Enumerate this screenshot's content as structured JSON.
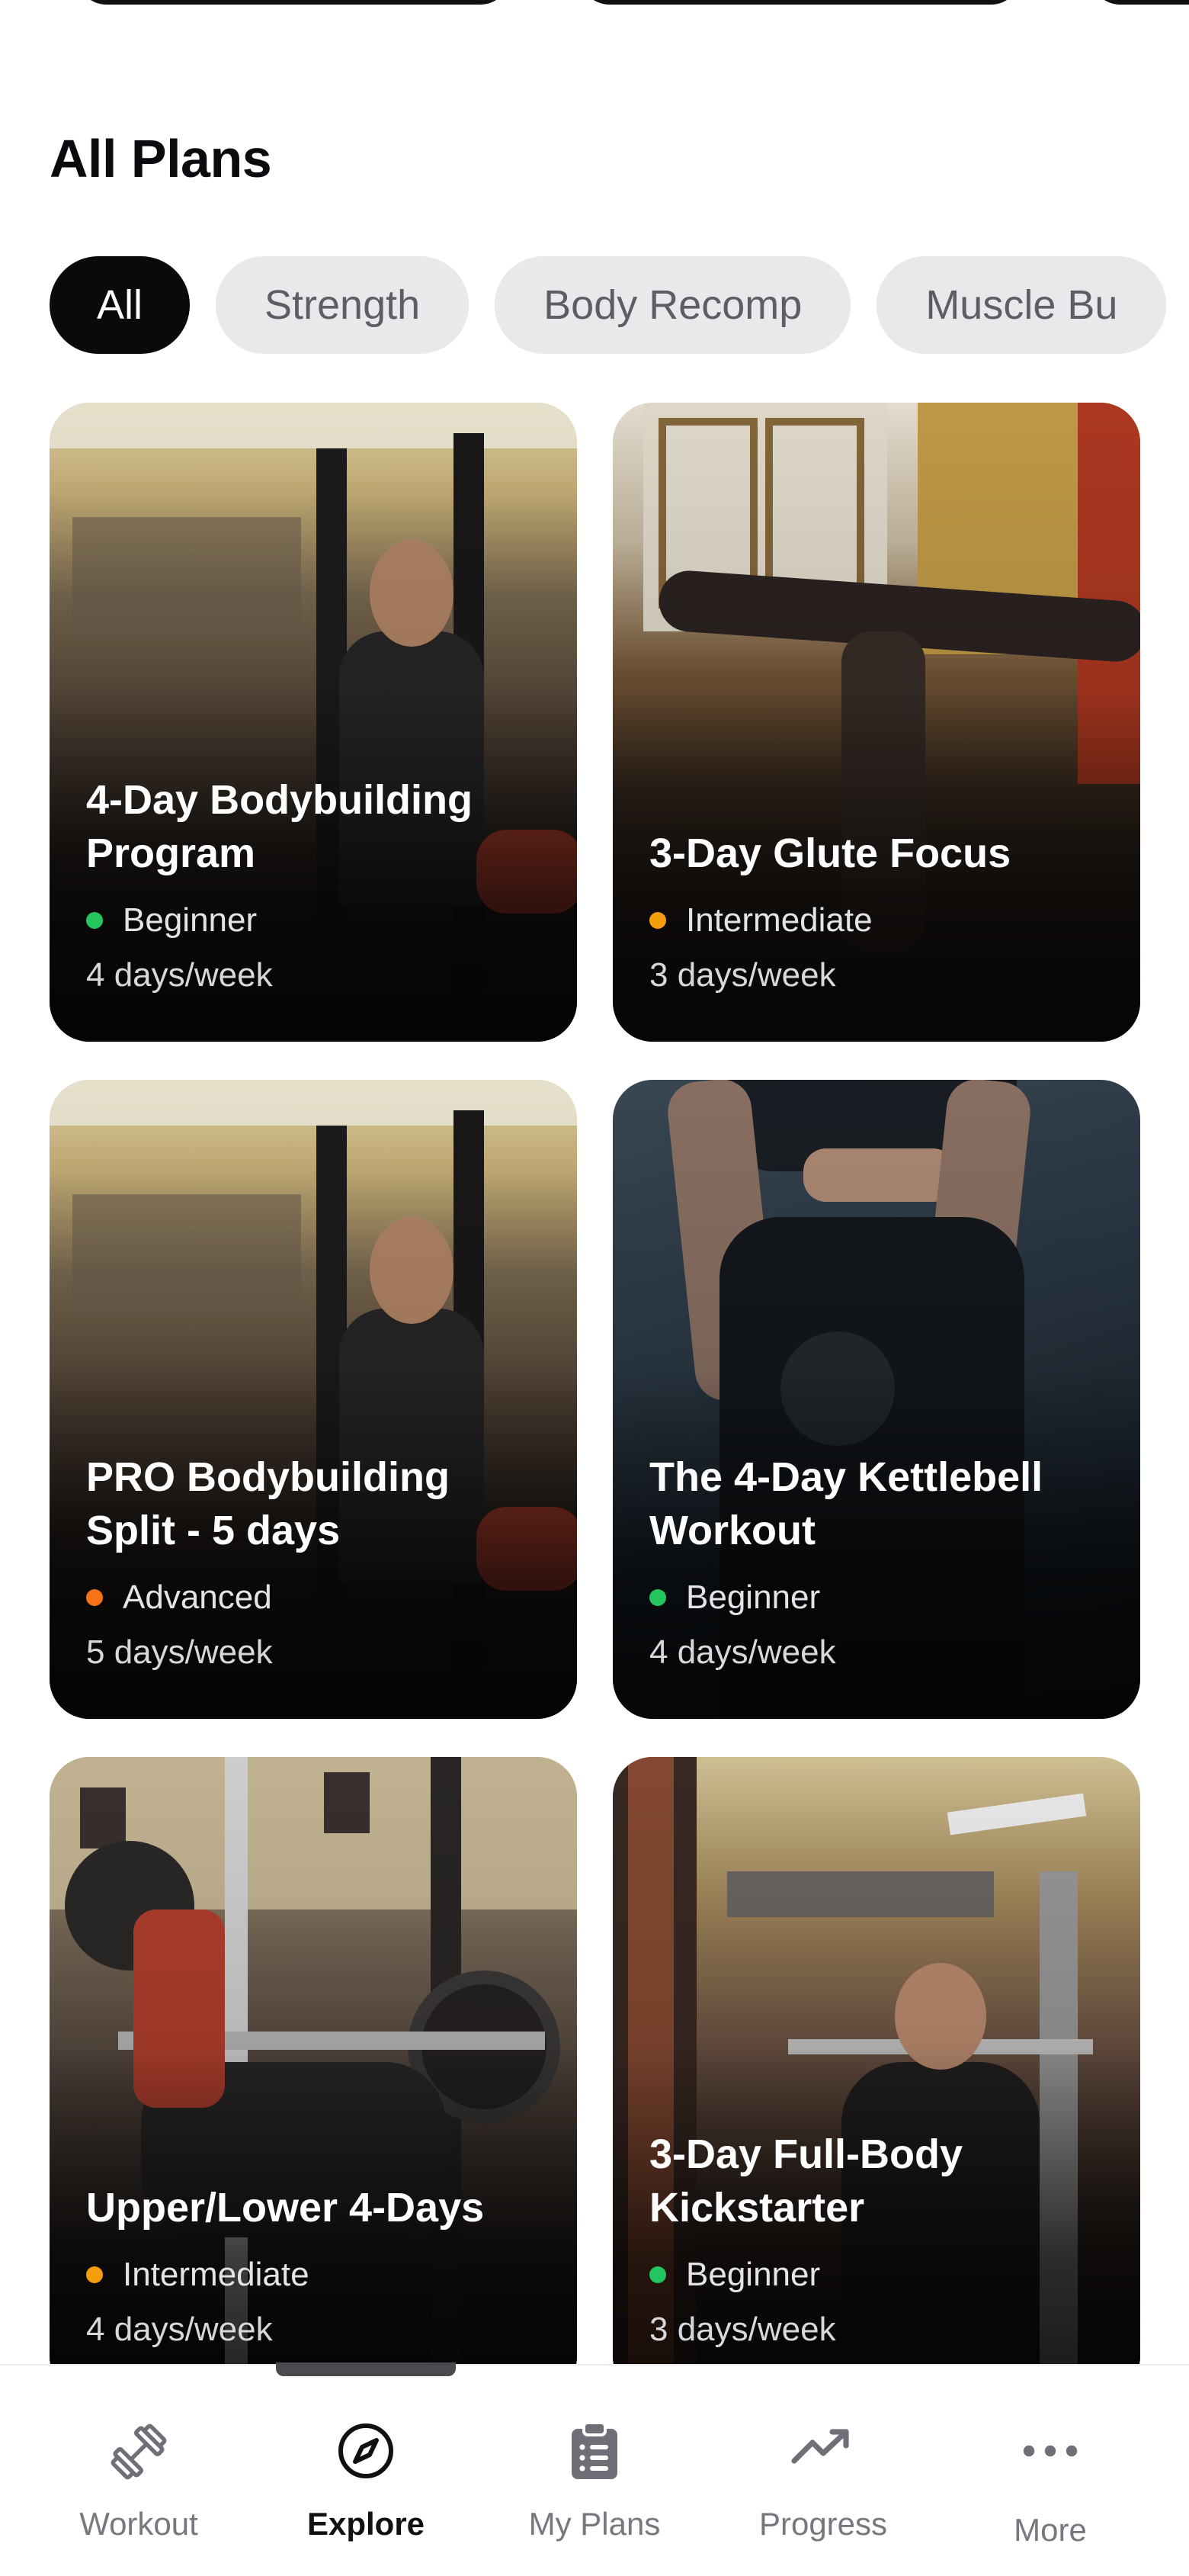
{
  "section": {
    "title": "All Plans"
  },
  "filters": [
    {
      "label": "All",
      "active": true
    },
    {
      "label": "Strength",
      "active": false
    },
    {
      "label": "Body Recomp",
      "active": false
    },
    {
      "label": "Muscle Bu",
      "active": false
    }
  ],
  "plans": [
    {
      "name": "4-Day Bodybuilding Program",
      "level": "Beginner",
      "level_color": "#22c55e",
      "frequency": "4 days/week"
    },
    {
      "name": "3-Day Glute Focus",
      "level": "Intermediate",
      "level_color": "#f59e0b",
      "frequency": "3 days/week"
    },
    {
      "name": "PRO Bodybuilding Split - 5 days",
      "level": "Advanced",
      "level_color": "#f97316",
      "frequency": "5 days/week"
    },
    {
      "name": "The 4-Day Kettlebell Workout",
      "level": "Beginner",
      "level_color": "#22c55e",
      "frequency": "4 days/week"
    },
    {
      "name": "Upper/Lower 4-Days",
      "level": "Intermediate",
      "level_color": "#f59e0b",
      "frequency": "4 days/week"
    },
    {
      "name": "3-Day Full-Body Kickstarter",
      "level": "Beginner",
      "level_color": "#22c55e",
      "frequency": "3 days/week"
    }
  ],
  "tabbar": {
    "workout": "Workout",
    "explore": "Explore",
    "my_plans": "My Plans",
    "progress": "Progress",
    "more": "More"
  }
}
